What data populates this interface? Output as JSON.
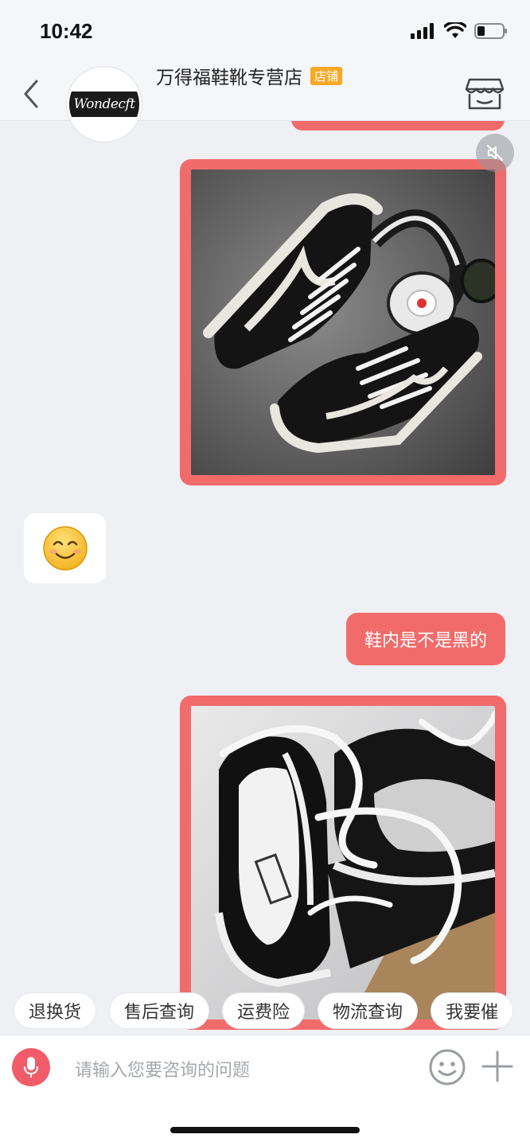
{
  "status_bar": {
    "time": "10:42"
  },
  "header": {
    "shop_name": "万得福鞋靴专营店",
    "shop_badge": "店铺",
    "avatar_logo_text": "Wondecft"
  },
  "messages": [
    {
      "from": "me",
      "type": "image",
      "subject": "black canvas sneakers with headphones"
    },
    {
      "from": "shop",
      "type": "emoji",
      "emoji": "smiling-face"
    },
    {
      "from": "me",
      "type": "text",
      "text": "鞋内是不是黑的"
    },
    {
      "from": "me",
      "type": "image",
      "subject": "photo of black sneakers with laces"
    }
  ],
  "quick_replies": [
    "退换货",
    "售后查询",
    "运费险",
    "物流查询",
    "我要催"
  ],
  "input": {
    "placeholder": "请输入您要咨询的问题"
  },
  "colors": {
    "accent": "#f26b6b",
    "badge": "#f9a825",
    "mic": "#f25c6a",
    "background": "#eef0f3"
  }
}
